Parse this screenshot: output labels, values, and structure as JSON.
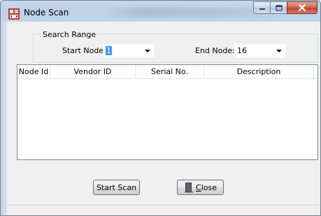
{
  "window": {
    "title": "Node Scan"
  },
  "search_range": {
    "label": "Search Range",
    "start_node": {
      "label": "Start Node:",
      "value": "1"
    },
    "end_node": {
      "label": "End Node:",
      "value": "16"
    }
  },
  "table": {
    "columns": [
      "Node Id",
      "Vendor ID",
      "Serial No.",
      "Description"
    ],
    "rows": []
  },
  "buttons": {
    "start_scan": "Start Scan",
    "close": "Close"
  },
  "icons": {
    "app": "node-scan-app-icon",
    "close_button": "exit-door-icon"
  }
}
